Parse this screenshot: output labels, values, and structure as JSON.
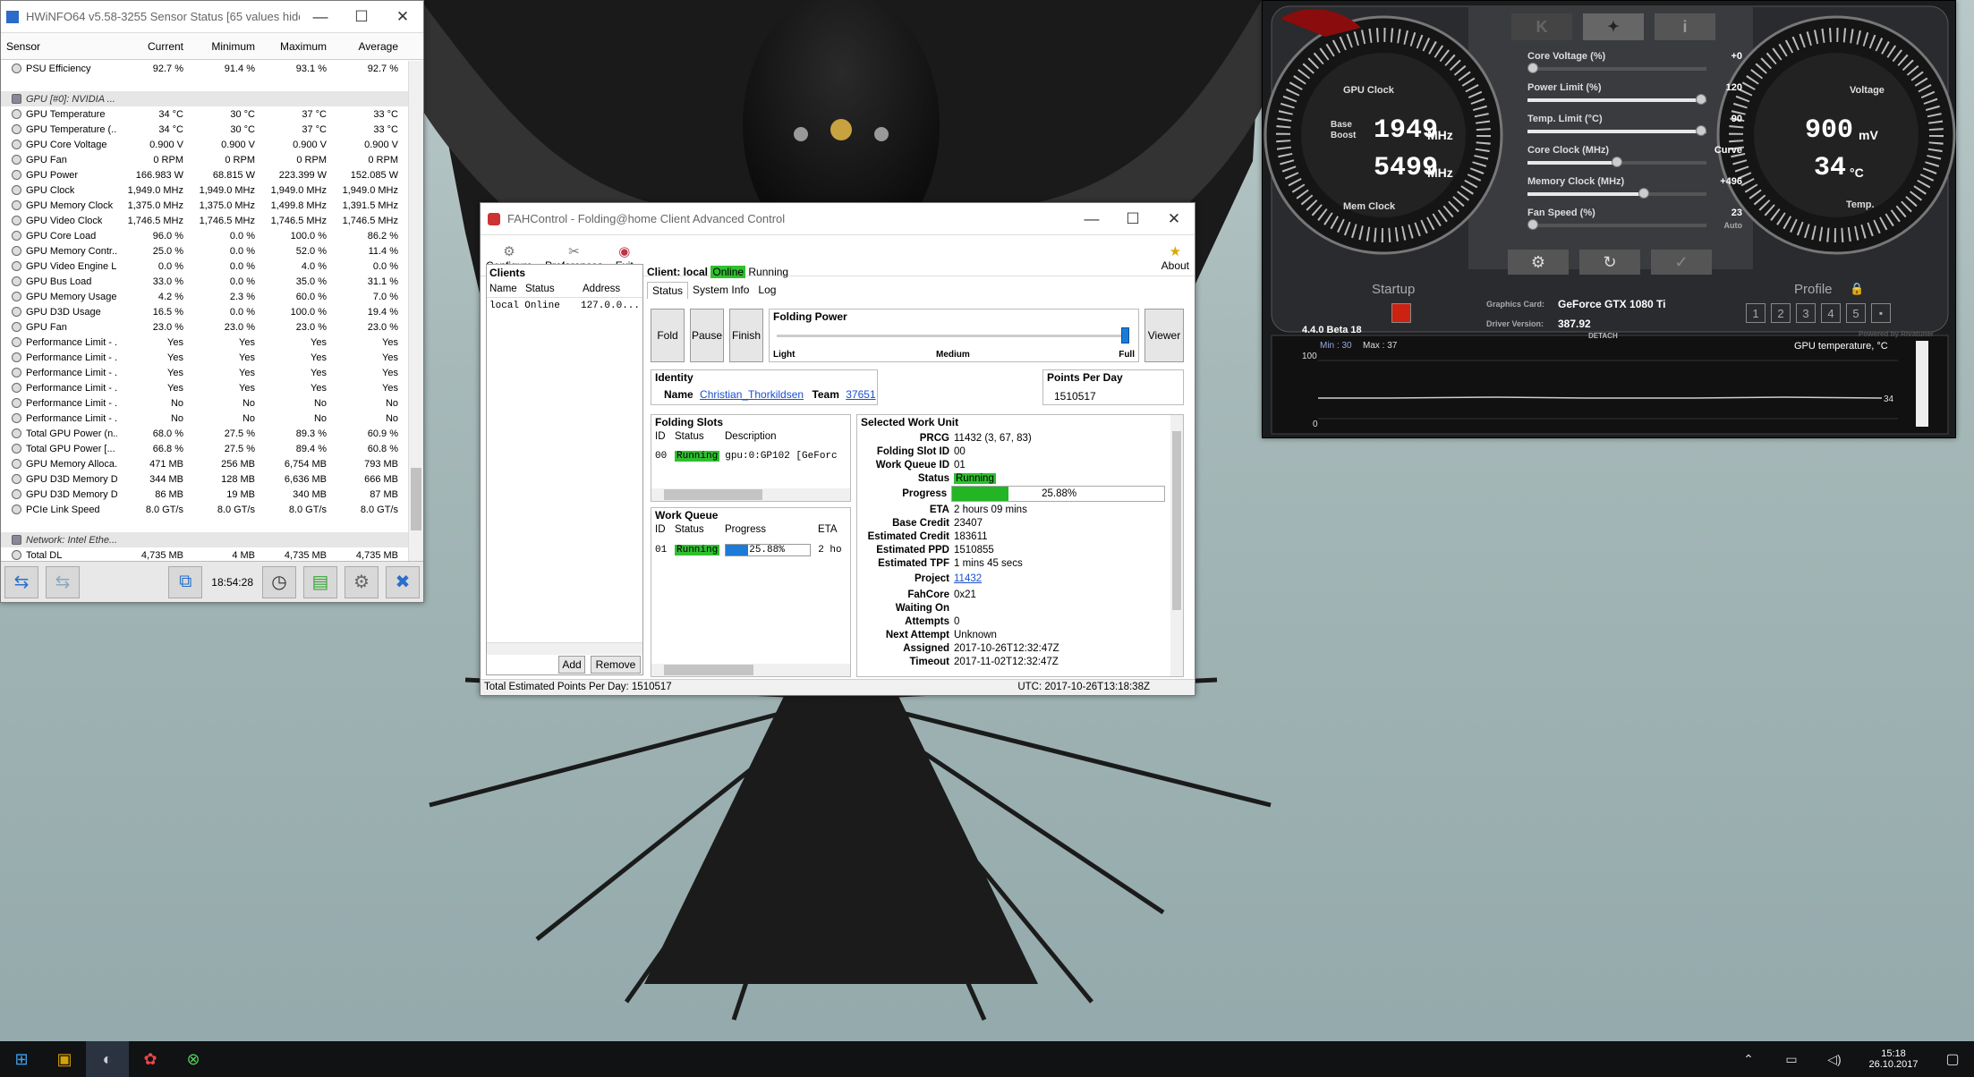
{
  "hwinfo": {
    "title": "HWiNFO64 v5.58-3255 Sensor Status [65 values hidden]",
    "columns": [
      "Sensor",
      "Current",
      "Minimum",
      "Maximum",
      "Average"
    ],
    "rows": [
      {
        "name": "PSU Efficiency",
        "cur": "92.7 %",
        "min": "91.4 %",
        "max": "93.1 %",
        "avg": "92.7 %"
      },
      {
        "name": "",
        "cur": "",
        "min": "",
        "max": "",
        "avg": "",
        "blank": true
      },
      {
        "name": "GPU [#0]: NVIDIA ...",
        "section": true
      },
      {
        "name": "GPU Temperature",
        "cur": "34 °C",
        "min": "30 °C",
        "max": "37 °C",
        "avg": "33 °C"
      },
      {
        "name": "GPU Temperature (...",
        "cur": "34 °C",
        "min": "30 °C",
        "max": "37 °C",
        "avg": "33 °C"
      },
      {
        "name": "GPU Core Voltage",
        "cur": "0.900 V",
        "min": "0.900 V",
        "max": "0.900 V",
        "avg": "0.900 V"
      },
      {
        "name": "GPU Fan",
        "cur": "0 RPM",
        "min": "0 RPM",
        "max": "0 RPM",
        "avg": "0 RPM"
      },
      {
        "name": "GPU Power",
        "cur": "166.983 W",
        "min": "68.815 W",
        "max": "223.399 W",
        "avg": "152.085 W"
      },
      {
        "name": "GPU Clock",
        "cur": "1,949.0 MHz",
        "min": "1,949.0 MHz",
        "max": "1,949.0 MHz",
        "avg": "1,949.0 MHz"
      },
      {
        "name": "GPU Memory Clock",
        "cur": "1,375.0 MHz",
        "min": "1,375.0 MHz",
        "max": "1,499.8 MHz",
        "avg": "1,391.5 MHz"
      },
      {
        "name": "GPU Video Clock",
        "cur": "1,746.5 MHz",
        "min": "1,746.5 MHz",
        "max": "1,746.5 MHz",
        "avg": "1,746.5 MHz"
      },
      {
        "name": "GPU Core Load",
        "cur": "96.0 %",
        "min": "0.0 %",
        "max": "100.0 %",
        "avg": "86.2 %"
      },
      {
        "name": "GPU Memory Contr...",
        "cur": "25.0 %",
        "min": "0.0 %",
        "max": "52.0 %",
        "avg": "11.4 %"
      },
      {
        "name": "GPU Video Engine L...",
        "cur": "0.0 %",
        "min": "0.0 %",
        "max": "4.0 %",
        "avg": "0.0 %"
      },
      {
        "name": "GPU Bus Load",
        "cur": "33.0 %",
        "min": "0.0 %",
        "max": "35.0 %",
        "avg": "31.1 %"
      },
      {
        "name": "GPU Memory Usage",
        "cur": "4.2 %",
        "min": "2.3 %",
        "max": "60.0 %",
        "avg": "7.0 %"
      },
      {
        "name": "GPU D3D Usage",
        "cur": "16.5 %",
        "min": "0.0 %",
        "max": "100.0 %",
        "avg": "19.4 %"
      },
      {
        "name": "GPU Fan",
        "cur": "23.0 %",
        "min": "23.0 %",
        "max": "23.0 %",
        "avg": "23.0 %"
      },
      {
        "name": "Performance Limit - ...",
        "cur": "Yes",
        "min": "Yes",
        "max": "Yes",
        "avg": "Yes"
      },
      {
        "name": "Performance Limit - ...",
        "cur": "Yes",
        "min": "Yes",
        "max": "Yes",
        "avg": "Yes"
      },
      {
        "name": "Performance Limit - ...",
        "cur": "Yes",
        "min": "Yes",
        "max": "Yes",
        "avg": "Yes"
      },
      {
        "name": "Performance Limit - ...",
        "cur": "Yes",
        "min": "Yes",
        "max": "Yes",
        "avg": "Yes"
      },
      {
        "name": "Performance Limit - ...",
        "cur": "No",
        "min": "No",
        "max": "No",
        "avg": "No"
      },
      {
        "name": "Performance Limit - ...",
        "cur": "No",
        "min": "No",
        "max": "No",
        "avg": "No"
      },
      {
        "name": "Total GPU Power (n...",
        "cur": "68.0 %",
        "min": "27.5 %",
        "max": "89.3 %",
        "avg": "60.9 %"
      },
      {
        "name": "Total GPU Power [...",
        "cur": "66.8 %",
        "min": "27.5 %",
        "max": "89.4 %",
        "avg": "60.8 %"
      },
      {
        "name": "GPU Memory Alloca...",
        "cur": "471 MB",
        "min": "256 MB",
        "max": "6,754 MB",
        "avg": "793 MB"
      },
      {
        "name": "GPU D3D Memory D...",
        "cur": "344 MB",
        "min": "128 MB",
        "max": "6,636 MB",
        "avg": "666 MB"
      },
      {
        "name": "GPU D3D Memory D...",
        "cur": "86 MB",
        "min": "19 MB",
        "max": "340 MB",
        "avg": "87 MB"
      },
      {
        "name": "PCIe Link Speed",
        "cur": "8.0 GT/s",
        "min": "8.0 GT/s",
        "max": "8.0 GT/s",
        "avg": "8.0 GT/s"
      },
      {
        "name": "",
        "cur": "",
        "min": "",
        "max": "",
        "avg": "",
        "blank": true
      },
      {
        "name": "Network: Intel Ethe...",
        "section": true
      },
      {
        "name": "Total DL",
        "cur": "4,735 MB",
        "min": "4 MB",
        "max": "4,735 MB",
        "avg": "4,735 MB"
      }
    ],
    "clock": "18:54:28"
  },
  "fah": {
    "title": "FAHControl - Folding@home Client Advanced Control",
    "menu": [
      "Configure",
      "Preferences",
      "Exit"
    ],
    "about": "About",
    "clients_label": "Clients",
    "clients_cols": [
      "Name",
      "Status",
      "Address"
    ],
    "client_row": [
      "local",
      "Online",
      "127.0.0..."
    ],
    "add": "Add",
    "remove": "Remove",
    "client_prefix": "Client: local",
    "client_online": "Online",
    "client_running": "Running",
    "tabs": [
      "Status",
      "System Info",
      "Log"
    ],
    "fold": "Fold",
    "pause": "Pause",
    "finish": "Finish",
    "viewer": "Viewer",
    "folding_power": "Folding Power",
    "fp_light": "Light",
    "fp_medium": "Medium",
    "fp_full": "Full",
    "folding_power_level": 1.0,
    "identity_label": "Identity",
    "name_label": "Name",
    "name_value": "Christian_Thorkildsen",
    "team_label": "Team",
    "team_value": "37651",
    "ppd_label": "Points Per Day",
    "ppd_value": "1510517",
    "slots_label": "Folding Slots",
    "slots_cols": [
      "ID",
      "Status",
      "Description"
    ],
    "slot_row": [
      "00",
      "Running",
      "gpu:0:GP102 [GeForc"
    ],
    "wq_label": "Work Queue",
    "wq_cols": [
      "ID",
      "Status",
      "Progress",
      "ETA"
    ],
    "wq_row": [
      "01",
      "Running",
      "25.88%",
      "2 ho"
    ],
    "swu_label": "Selected Work Unit",
    "wu": [
      [
        "PRCG",
        "11432 (3, 67, 83)"
      ],
      [
        "Folding Slot ID",
        "00"
      ],
      [
        "Work Queue ID",
        "01"
      ]
    ],
    "status_k": "Status",
    "status_v": "Running",
    "progress_k": "Progress",
    "progress_v": "25.88%",
    "progress_frac": 0.2588,
    "wu2": [
      [
        "ETA",
        "2 hours 09 mins"
      ],
      [
        "Base Credit",
        "23407"
      ],
      [
        "Estimated Credit",
        "183611"
      ],
      [
        "Estimated PPD",
        "1510855"
      ],
      [
        "Estimated TPF",
        "1 mins 45 secs"
      ]
    ],
    "project_k": "Project",
    "project_v": "11432",
    "wu3": [
      [
        "FahCore",
        "0x21"
      ],
      [
        "Waiting On",
        ""
      ],
      [
        "Attempts",
        "0"
      ],
      [
        "Next Attempt",
        "Unknown"
      ],
      [
        "Assigned",
        "2017-10-26T12:32:47Z"
      ],
      [
        "Timeout",
        "2017-11-02T12:32:47Z"
      ]
    ],
    "status_total": "Total Estimated Points Per Day: 1510517",
    "status_utc": "UTC: 2017-10-26T13:18:38Z"
  },
  "ab": {
    "gpu_clock_label": "GPU Clock",
    "mem_clock_label": "Mem Clock",
    "base": "Base",
    "boost": "Boost",
    "gpu_clock": "1949",
    "mem_clock": "5499",
    "mhz": "MHz",
    "voltage_label": "Voltage",
    "voltage": "900",
    "mv": "mV",
    "temp_label": "Temp.",
    "temp": "34",
    "degc": "°C",
    "sliders": [
      {
        "label": "Core Voltage (%)",
        "value": "+0",
        "level": 0
      },
      {
        "label": "Power Limit (%)",
        "value": "120",
        "level": 1.0
      },
      {
        "label": "Temp. Limit (°C)",
        "value": "90",
        "level": 1.0
      },
      {
        "label": "Core Clock (MHz)",
        "value": "Curve",
        "level": 0.5
      },
      {
        "label": "Memory Clock (MHz)",
        "value": "+496",
        "level": 0.66
      },
      {
        "label": "Fan Speed (%)",
        "value": "23",
        "level": 0
      }
    ],
    "auto": "Auto",
    "startup": "Startup",
    "profile": "Profile",
    "gc_label": "Graphics Card:",
    "gc_value": "GeForce GTX 1080 Ti",
    "dv_label": "Driver Version:",
    "dv_value": "387.92",
    "version": "4.4.0 Beta 18",
    "detach": "DETACH",
    "powered": "Powered by Rivatuner",
    "graph_min": "Min : 30",
    "graph_max": "Max : 37",
    "graph_title": "GPU temperature, °C",
    "graph_top": "100",
    "graph_bottom": "0",
    "graph_val": "34",
    "profiles": [
      "1",
      "2",
      "3",
      "4",
      "5"
    ],
    "top_k": "K",
    "top_i": "i"
  },
  "taskbar": {
    "time": "15:18",
    "date": "26.10.2017"
  }
}
